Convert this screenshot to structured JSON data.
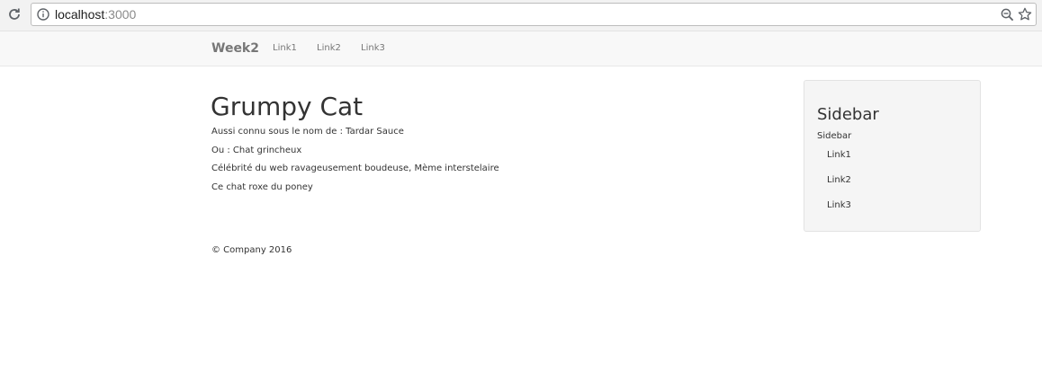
{
  "browser": {
    "url_host": "localhost",
    "url_port": ":3000",
    "icons": {
      "reload": "reload-icon",
      "info": "info-icon",
      "zoom": "zoom-out-icon",
      "bookmark": "star-icon"
    }
  },
  "navbar": {
    "brand": "Week2",
    "links": [
      "Link1",
      "Link2",
      "Link3"
    ]
  },
  "main": {
    "title": "Grumpy Cat",
    "paragraphs": [
      "Aussi connu sous le nom de : Tardar Sauce",
      "Ou : Chat grincheux",
      "Célébrité du web ravageusement boudeuse, Mème interstelaire",
      "Ce chat roxe du poney"
    ]
  },
  "sidebar": {
    "title": "Sidebar",
    "subtitle": "Sidebar",
    "links": [
      "Link1",
      "Link2",
      "Link3"
    ]
  },
  "footer": {
    "text": "© Company 2016"
  },
  "colors": {
    "navbar_bg": "#f8f8f8",
    "nav_text": "#777777",
    "body_text": "#333333",
    "well_bg": "#f5f5f5"
  }
}
